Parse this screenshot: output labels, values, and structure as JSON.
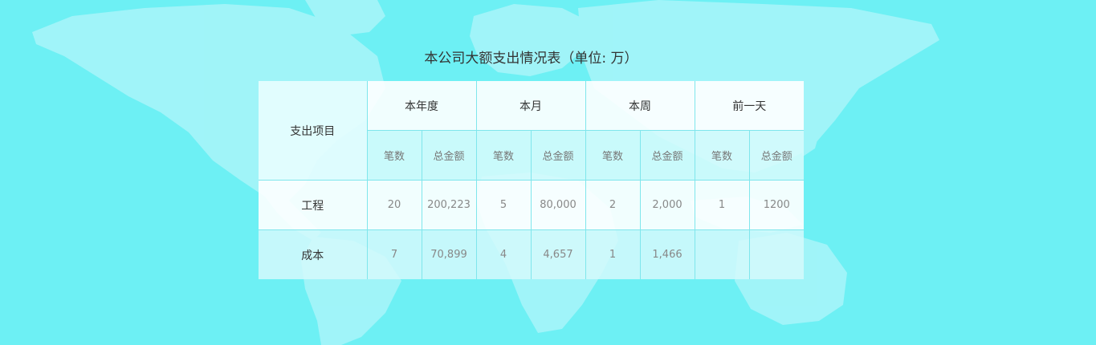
{
  "title": "本公司大额支出情况表（单位: 万）",
  "table": {
    "corner_label": "支出项目",
    "periods": [
      "本年度",
      "本月",
      "本周",
      "前一天"
    ],
    "sub_headers": [
      "笔数",
      "总金额"
    ],
    "rows": [
      {
        "label": "工程",
        "cells": [
          "20",
          "200,223",
          "5",
          "80,000",
          "2",
          "2,000",
          "1",
          "1200"
        ]
      },
      {
        "label": "成本",
        "cells": [
          "7",
          "70,899",
          "4",
          "4,657",
          "1",
          "1,466",
          "",
          ""
        ]
      }
    ]
  },
  "colors": {
    "background": "#6df0f4",
    "continents": "#a8f4f8",
    "border": "#7fe6ec"
  }
}
